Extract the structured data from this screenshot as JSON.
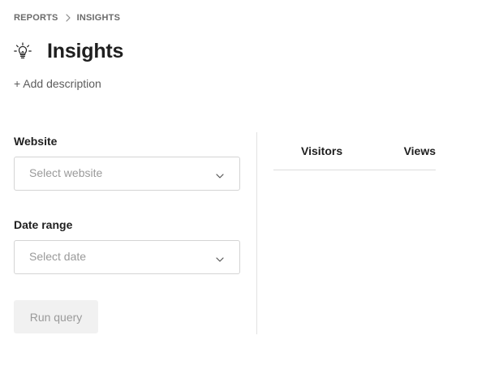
{
  "breadcrumb": {
    "items": [
      "REPORTS",
      "INSIGHTS"
    ]
  },
  "header": {
    "icon": "lightbulb-icon",
    "title": "Insights",
    "add_description": "+ Add description"
  },
  "form": {
    "website": {
      "label": "Website",
      "placeholder": "Select website"
    },
    "date_range": {
      "label": "Date range",
      "placeholder": "Select date"
    },
    "run_label": "Run query"
  },
  "results": {
    "columns": [
      "Visitors",
      "Views"
    ]
  },
  "colors": {
    "text": "#1f1f1f",
    "muted": "#6b6b6b",
    "placeholder": "#9a9a9a",
    "border": "#d4d4d4",
    "button_bg": "#f1f1f1"
  }
}
